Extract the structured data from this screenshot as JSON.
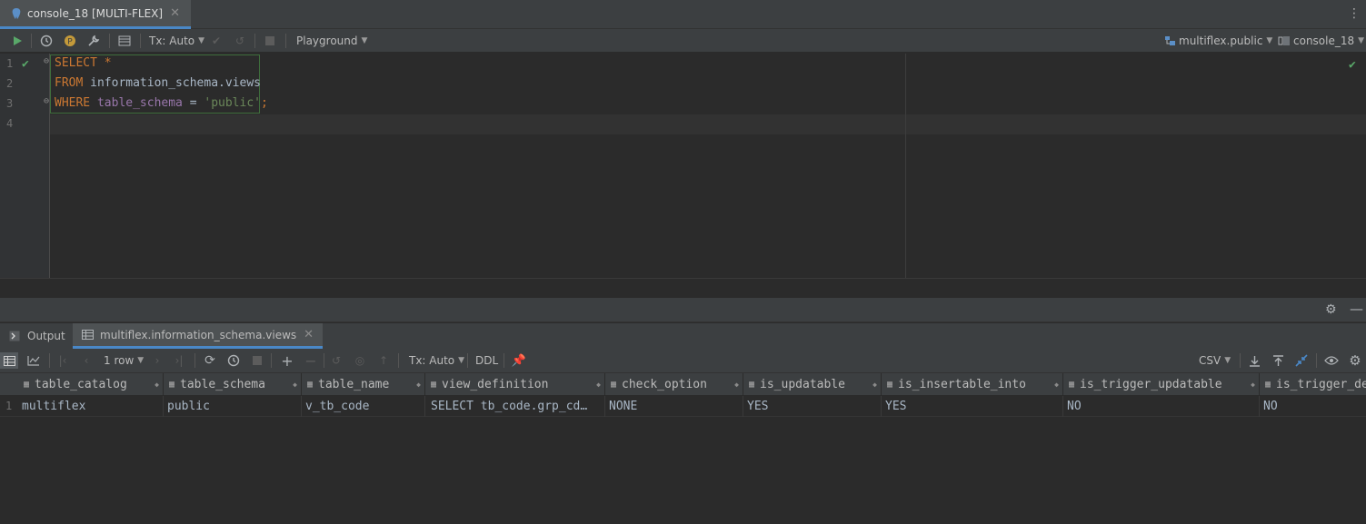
{
  "editor_tab": {
    "label": "console_18 [MULTI-FLEX]"
  },
  "toolbar": {
    "tx_mode": "Tx: Auto",
    "playground": "Playground",
    "schema": "multiflex.public",
    "session": "console_18"
  },
  "code": {
    "line_numbers": [
      "1",
      "2",
      "3",
      "4"
    ],
    "line1": {
      "kw": "SELECT",
      "rest": " *"
    },
    "line2": {
      "kw": "FROM",
      "rest": " information_schema.views"
    },
    "line3": {
      "kw": "WHERE",
      "col": " table_schema",
      "op": " = ",
      "str": "'public'",
      "end": ";"
    }
  },
  "results_tabs": {
    "output": "Output",
    "views": "multiflex.information_schema.views"
  },
  "results_toolbar": {
    "rows": "1 row",
    "tx_mode": "Tx: Auto",
    "ddl": "DDL",
    "export_format": "CSV"
  },
  "grid": {
    "columns": [
      "table_catalog",
      "table_schema",
      "table_name",
      "view_definition",
      "check_option",
      "is_updatable",
      "is_insertable_into",
      "is_trigger_updatable",
      "is_trigger_de"
    ],
    "row_number": "1",
    "row": [
      "multiflex",
      "public",
      "v_tb_code",
      " SELECT tb_code.grp_cd…",
      "NONE",
      "YES",
      "YES",
      "NO",
      "NO"
    ]
  },
  "colors": {
    "accent": "#4a88c7",
    "run_green": "#59a869",
    "keyword": "#cc7832",
    "string": "#6a8759",
    "column": "#9876aa"
  }
}
